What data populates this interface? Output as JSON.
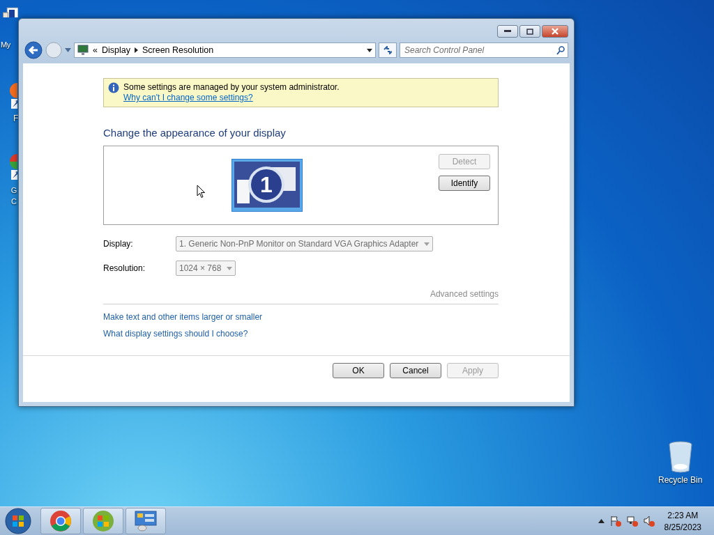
{
  "desktop": {
    "icons": [
      {
        "kind": "computer",
        "label": "My"
      },
      {
        "kind": "shortcut-orange",
        "label": "F"
      },
      {
        "kind": "shortcut-green",
        "label": "G C"
      },
      {
        "kind": "recycle-bin",
        "label": "Recycle Bin"
      }
    ]
  },
  "window": {
    "address": {
      "overflow": "«",
      "crumbs": [
        "Display",
        "Screen Resolution"
      ]
    },
    "search": {
      "placeholder": "Search Control Panel"
    },
    "notice": {
      "message": "Some settings are managed by your system administrator.",
      "link": "Why can't I change some settings?"
    },
    "heading": "Change the appearance of your display",
    "monitor": {
      "number": "1",
      "selected": true
    },
    "side_buttons": [
      {
        "label": "Detect",
        "disabled": true
      },
      {
        "label": "Identify",
        "disabled": false
      }
    ],
    "fields": [
      {
        "label": "Display:",
        "value": "1. Generic Non-PnP Monitor on Standard VGA Graphics Adapter",
        "disabled": true
      },
      {
        "label": "Resolution:",
        "value": "1024 × 768",
        "disabled": true
      }
    ],
    "advanced": {
      "label": "Advanced settings",
      "disabled": true
    },
    "links": [
      "Make text and other items larger or smaller",
      "What display settings should I choose?"
    ],
    "buttons": [
      {
        "label": "OK",
        "disabled": false
      },
      {
        "label": "Cancel",
        "disabled": false
      },
      {
        "label": "Apply",
        "disabled": true
      }
    ]
  },
  "taskbar": {
    "items": [
      {
        "kind": "chrome"
      },
      {
        "kind": "windows"
      },
      {
        "kind": "control-panel"
      }
    ],
    "clock": {
      "time": "2:23 AM",
      "date": "8/25/2023"
    }
  }
}
